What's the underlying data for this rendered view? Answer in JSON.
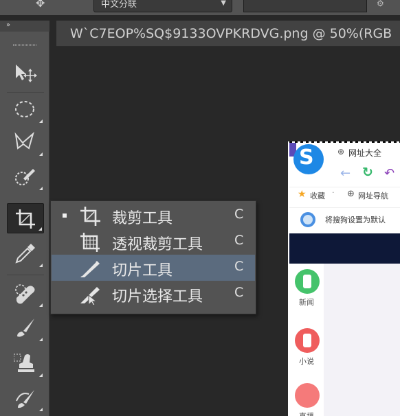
{
  "options_bar": {
    "dropdown_value": "中文分联",
    "chevron": "chevron-down-icon"
  },
  "toolbox": {
    "collapse_glyph": "»",
    "tools": [
      {
        "name": "move-tool",
        "icon": "move-icon"
      },
      {
        "name": "elliptical-marquee-tool",
        "icon": "ellipse-marquee-icon"
      },
      {
        "name": "polygonal-lasso-tool",
        "icon": "polygonal-lasso-icon"
      },
      {
        "name": "quick-selection-tool",
        "icon": "quick-selection-icon"
      },
      {
        "name": "crop-tool",
        "icon": "crop-icon",
        "active": true
      },
      {
        "name": "eyedropper-tool",
        "icon": "eyedropper-icon"
      },
      {
        "name": "spot-healing-tool",
        "icon": "bandage-icon"
      },
      {
        "name": "brush-tool",
        "icon": "brush-icon"
      },
      {
        "name": "clone-stamp-tool",
        "icon": "stamp-icon"
      },
      {
        "name": "history-brush-tool",
        "icon": "history-brush-icon"
      }
    ]
  },
  "document": {
    "tab_title": "W`C7EOP%SQ$9133OVPKRDVG.png @ 50%(RGB"
  },
  "flyout_menu": {
    "items": [
      {
        "label": "裁剪工具",
        "shortcut": "C",
        "selected": true,
        "highlighted": false,
        "icon": "crop-icon"
      },
      {
        "label": "透视裁剪工具",
        "shortcut": "C",
        "selected": false,
        "highlighted": false,
        "icon": "perspective-crop-icon"
      },
      {
        "label": "切片工具",
        "shortcut": "C",
        "selected": false,
        "highlighted": true,
        "icon": "slice-icon"
      },
      {
        "label": "切片选择工具",
        "shortcut": "C",
        "selected": false,
        "highlighted": false,
        "icon": "slice-select-icon"
      }
    ]
  },
  "canvas_image": {
    "top_label": "网址大全",
    "bookmark_fav": "收藏",
    "bookmark_sep": "·",
    "bookmark_nav": "网址导航",
    "notice": "将搜狗设置为默认",
    "apps": [
      "新闻",
      "小说",
      "直播"
    ],
    "colors": {
      "brand_blue": "#1e88e5",
      "reload_green": "#35b86b",
      "undo_purple": "#8a3fb8"
    }
  }
}
